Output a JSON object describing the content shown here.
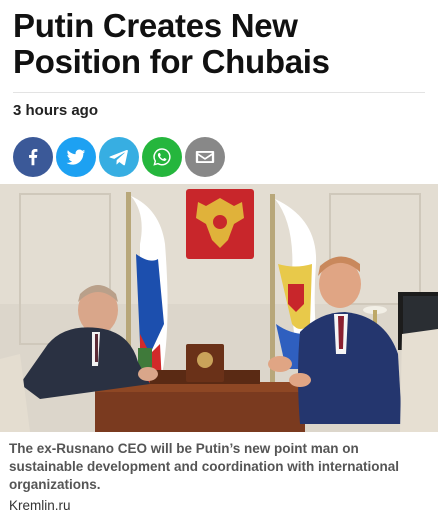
{
  "article": {
    "headline": "Putin Creates New Position for Chubais",
    "timestamp": "3 hours ago",
    "caption": "The ex-Rusnano CEO will be Putin’s new point man on sustainable development and coordination with international organizations.",
    "photo_credit": "Kremlin.ru"
  },
  "share_buttons": [
    {
      "icon": "facebook-icon",
      "color": "#3b5998"
    },
    {
      "icon": "twitter-icon",
      "color": "#1da1f2"
    },
    {
      "icon": "telegram-icon",
      "color": "#37aee2"
    },
    {
      "icon": "whatsapp-icon",
      "color": "#25b63d"
    },
    {
      "icon": "email-icon",
      "color": "#888888"
    }
  ]
}
